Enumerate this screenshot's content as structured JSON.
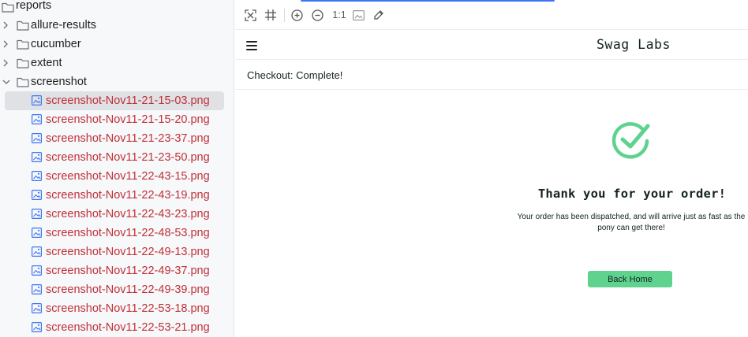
{
  "tree": {
    "root": {
      "label": "reports",
      "icon": "folder-icon"
    },
    "folders": [
      {
        "label": "allure-results",
        "expanded": false
      },
      {
        "label": "cucumber",
        "expanded": false
      },
      {
        "label": "extent",
        "expanded": false
      },
      {
        "label": "screenshot",
        "expanded": true
      }
    ],
    "files": [
      {
        "label": "screenshot-Nov11-21-15-03.png",
        "selected": true
      },
      {
        "label": "screenshot-Nov11-21-15-20.png"
      },
      {
        "label": "screenshot-Nov11-21-23-37.png"
      },
      {
        "label": "screenshot-Nov11-21-23-50.png"
      },
      {
        "label": "screenshot-Nov11-22-43-15.png"
      },
      {
        "label": "screenshot-Nov11-22-43-19.png"
      },
      {
        "label": "screenshot-Nov11-22-43-23.png"
      },
      {
        "label": "screenshot-Nov11-22-48-53.png"
      },
      {
        "label": "screenshot-Nov11-22-49-13.png"
      },
      {
        "label": "screenshot-Nov11-22-49-37.png"
      },
      {
        "label": "screenshot-Nov11-22-49-39.png"
      },
      {
        "label": "screenshot-Nov11-22-53-18.png"
      },
      {
        "label": "screenshot-Nov11-22-53-21.png"
      }
    ]
  },
  "toolbar": {
    "zoom_actual_label": "1:1",
    "icons": [
      "fit-screen-icon",
      "grid-icon",
      "zoom-in-icon",
      "zoom-out-icon",
      "actual-size-icon",
      "background-icon",
      "color-picker-icon"
    ]
  },
  "app": {
    "logo": "Swag Labs",
    "page_title": "Checkout: Complete!",
    "heading": "Thank you for your order!",
    "message": "Your order has been dispatched, and will arrive just as fast as the pony can get there!",
    "back_button": "Back Home"
  },
  "colors": {
    "file_text": "#c03038",
    "accent": "#3d74f5",
    "success": "#5fd38e",
    "text_dark": "#132322"
  }
}
